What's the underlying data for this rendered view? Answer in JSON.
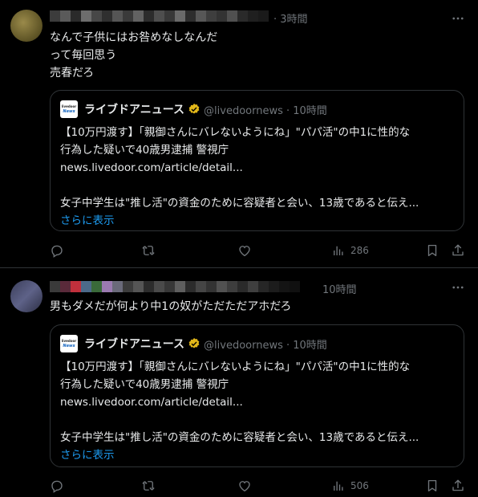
{
  "tweets": [
    {
      "time": "· 3時間",
      "text": "なんで子供にはお咎めなしなんだ\nって毎回思う\n売春だろ",
      "quote": {
        "logo_top": "livedoor",
        "logo_bottom": "News",
        "name": "ライブドアニュース",
        "handle": "@livedoornews · 10時間",
        "lines": [
          "【10万円渡す】「親御さんにバレないようにね」\"パパ活\"の中1に性的な",
          "行為した疑いで40歳男逮捕 警視庁",
          "news.livedoor.com/article/detail...",
          "",
          "女子中学生は\"推し活\"の資金のために容疑者と会い、13歳であると伝え..."
        ],
        "more": "さらに表示"
      },
      "views": "286"
    },
    {
      "time": "10時間",
      "text": "男もダメだが何より中1の奴がただただアホだろ",
      "quote": {
        "logo_top": "livedoor",
        "logo_bottom": "News",
        "name": "ライブドアニュース",
        "handle": "@livedoornews · 10時間",
        "lines": [
          "【10万円渡す】「親御さんにバレないようにね」\"パパ活\"の中1に性的な",
          "行為した疑いで40歳男逮捕 警視庁",
          "news.livedoor.com/article/detail...",
          "",
          "女子中学生は\"推し活\"の資金のために容疑者と会い、13歳であると伝え..."
        ],
        "more": "さらに表示"
      },
      "views": "506"
    }
  ],
  "colors": {
    "background": "#000000",
    "text": "#e7e9ea",
    "muted": "#71767b",
    "link": "#1d9bf0",
    "border": "#2f3336",
    "verified": "#e2b719"
  },
  "icons": [
    "reply-icon",
    "retweet-icon",
    "like-icon",
    "views-icon",
    "bookmark-icon",
    "share-icon",
    "more-icon",
    "verified-badge-icon"
  ]
}
